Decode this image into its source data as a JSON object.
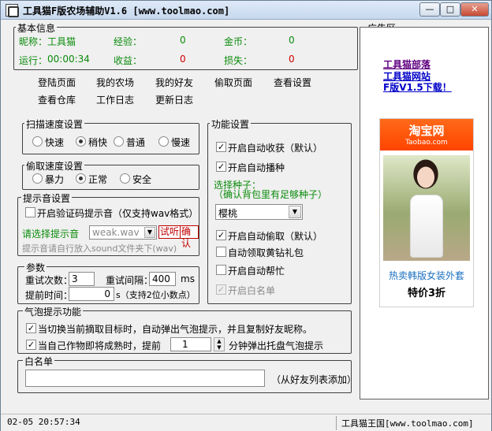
{
  "window": {
    "title": "工具猫F版农场辅助V1.6 [www.toolmao.com]",
    "min_label": "—",
    "max_label": "□",
    "close_label": "✕"
  },
  "basic_info": {
    "title": "基本信息",
    "nickname_label": "昵称：",
    "nickname_value": "工具猫",
    "exp_label": "经验：",
    "exp_value": "0",
    "gold_label": "金币：",
    "gold_value": "0",
    "runtime_label": "运行：",
    "runtime_value": "00:00:34",
    "income_label": "收益：",
    "income_value": "0",
    "loss_label": "损失：",
    "loss_value": "0"
  },
  "nav": {
    "row1": [
      "登陆页面",
      "我的农场",
      "我的好友",
      "偷取页面",
      "查看设置"
    ],
    "row2": [
      "查看仓库",
      "工作日志",
      "更新日志"
    ]
  },
  "scan_speed": {
    "title": "扫描速度设置",
    "options": [
      "快速",
      "稍快",
      "普通",
      "慢速"
    ],
    "selected": 1
  },
  "steal_speed": {
    "title": "偷取速度设置",
    "options": [
      "暴力",
      "正常",
      "安全"
    ],
    "selected": 1
  },
  "sound": {
    "title": "提示音设置",
    "enable_label": "开启验证码提示音（仅支持wav格式）",
    "select_label": "请选择提示音",
    "select_value": "weak.wav",
    "listen_label": "试听",
    "confirm_label": "确认",
    "hint": "提示音请自行放入sound文件夹下(wav)"
  },
  "params": {
    "title": "参数",
    "retry_count_label": "重试次数：",
    "retry_count_value": "3",
    "retry_interval_label": "重试间隔：",
    "retry_interval_value": "400",
    "retry_interval_unit": "ms",
    "advance_label": "提前时间：",
    "advance_value": "0",
    "advance_unit": "s（支持2位小数点）"
  },
  "balloon": {
    "title": "气泡提示功能",
    "item1": "当切换当前摘取目标时，自动弹出气泡提示，并且复制好友昵称。",
    "item2_prefix": "当自己作物即将成熟时，提前",
    "item2_value": "1",
    "item2_suffix": "分钟弹出托盘气泡提示"
  },
  "whitelist": {
    "title": "白名单",
    "input_value": "",
    "hint": "（从好友列表添加）"
  },
  "features": {
    "title": "功能设置",
    "auto_harvest": "开启自动收获（默认）",
    "auto_sow": "开启自动播种",
    "seed_label_1": "选择种子：",
    "seed_label_2": "（确认背包里有足够种子）",
    "seed_value": "樱桃",
    "auto_steal": "开启自动偷取（默认）",
    "auto_diamond": "自动领取黄钻礼包",
    "auto_help": "开启自动帮忙",
    "whitelist_toggle": "开启白名单"
  },
  "ad": {
    "title": "广告区",
    "link1": "工具猫部落",
    "link2": "工具猫网站",
    "link3": "F版V1.5下载！",
    "taobao_title": "淘宝网",
    "taobao_sub": "Taobao.com",
    "caption1": "热卖韩版女装外套",
    "caption2": "特价3折"
  },
  "status": {
    "datetime": "02-05 20:57:34",
    "brand": "工具猫王国[www.toolmao.com]"
  }
}
